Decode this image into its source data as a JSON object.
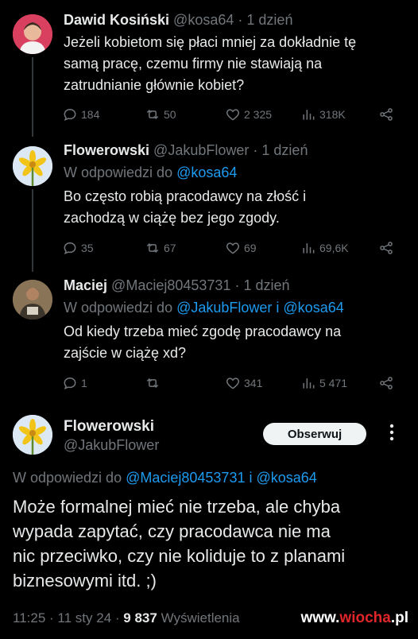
{
  "tweets": [
    {
      "name": "Dawid Kosiński",
      "handle": "@kosa64",
      "sep": "·",
      "time": "1 dzień",
      "text_lines": [
        "Jeżeli kobietom się płaci mniej za dokładnie tę",
        "samą pracę, czemu firmy nie stawiają na",
        "zatrudnianie głównie kobiet?"
      ],
      "replies": "184",
      "retweets": "50",
      "likes": "2 325",
      "views": "318K"
    },
    {
      "name": "Flowerowski",
      "handle": "@JakubFlower",
      "sep": "·",
      "time": "1 dzień",
      "reply_prefix": "W odpowiedzi do",
      "reply_mention": "@kosa64",
      "text_lines": [
        "Bo często robią pracodawcy na złość i",
        "zachodzą w ciążę bez jego zgody."
      ],
      "replies": "35",
      "retweets": "67",
      "likes": "69",
      "views": "69,6K"
    },
    {
      "name": "Maciej",
      "handle": "@Maciej80453731",
      "sep": "·",
      "time": "1 dzień",
      "reply_prefix": "W odpowiedzi do",
      "reply_mention": "@JakubFlower i @kosa64",
      "text_lines": [
        "Od kiedy trzeba mieć zgodę pracodawcy na",
        "zajście w ciążę xd?"
      ],
      "replies": "1",
      "retweets": "",
      "likes": "341",
      "views": "5 471"
    }
  ],
  "main": {
    "name": "Flowerowski",
    "handle": "@JakubFlower",
    "follow_label": "Obserwuj",
    "reply_prefix": "W odpowiedzi do",
    "reply_mention": "@Maciej80453731 i @kosa64",
    "text_lines": [
      "Może formalnej mieć nie trzeba, ale chyba",
      "wypada zapytać, czy pracodawca nie ma",
      "nic przeciwko, czy nie koliduje to z planami",
      "biznesowymi itd. ;)"
    ],
    "time": "11:25",
    "date": "11 sty 24",
    "sep": "·",
    "views_count": "9 837",
    "views_label": "Wyświetlenia"
  },
  "watermark": {
    "prefix": "www.",
    "brand": "wiocha",
    "suffix": ".pl"
  },
  "colors": {
    "background": "#000000",
    "text": "#e7e9ea",
    "muted": "#71767b",
    "link": "#1d9bf0",
    "button": "#eff3f4"
  }
}
